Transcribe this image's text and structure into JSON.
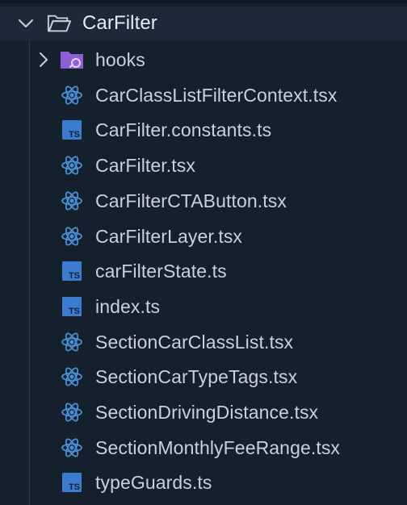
{
  "root": {
    "label": "CarFilter",
    "expanded": true,
    "chevron_icon": "chevron-down-icon",
    "icon": "folder-open-icon"
  },
  "items": [
    {
      "label": "hooks",
      "kind": "folder",
      "icon": "folder-hooks-icon",
      "expanded": false,
      "chevron_icon": "chevron-right-icon"
    },
    {
      "label": "CarClassListFilterContext.tsx",
      "kind": "tsx",
      "icon": "react-icon"
    },
    {
      "label": "CarFilter.constants.ts",
      "kind": "ts",
      "icon": "typescript-icon",
      "badge": "TS"
    },
    {
      "label": "CarFilter.tsx",
      "kind": "tsx",
      "icon": "react-icon"
    },
    {
      "label": "CarFilterCTAButton.tsx",
      "kind": "tsx",
      "icon": "react-icon"
    },
    {
      "label": "CarFilterLayer.tsx",
      "kind": "tsx",
      "icon": "react-icon"
    },
    {
      "label": "carFilterState.ts",
      "kind": "ts",
      "icon": "typescript-icon",
      "badge": "TS"
    },
    {
      "label": "index.ts",
      "kind": "ts",
      "icon": "typescript-icon",
      "badge": "TS"
    },
    {
      "label": "SectionCarClassList.tsx",
      "kind": "tsx",
      "icon": "react-icon"
    },
    {
      "label": "SectionCarTypeTags.tsx",
      "kind": "tsx",
      "icon": "react-icon"
    },
    {
      "label": "SectionDrivingDistance.tsx",
      "kind": "tsx",
      "icon": "react-icon"
    },
    {
      "label": "SectionMonthlyFeeRange.tsx",
      "kind": "tsx",
      "icon": "react-icon"
    },
    {
      "label": "typeGuards.ts",
      "kind": "ts",
      "icon": "typescript-icon",
      "badge": "TS"
    }
  ],
  "colors": {
    "background": "#14212d",
    "selected_row": "#1c2a37",
    "text": "#c9d1d9",
    "react": "#4b8fd9",
    "typescript": "#3b7bd0",
    "folder_hooks": "#8f5fd6",
    "chevron": "#c9d1d9"
  }
}
